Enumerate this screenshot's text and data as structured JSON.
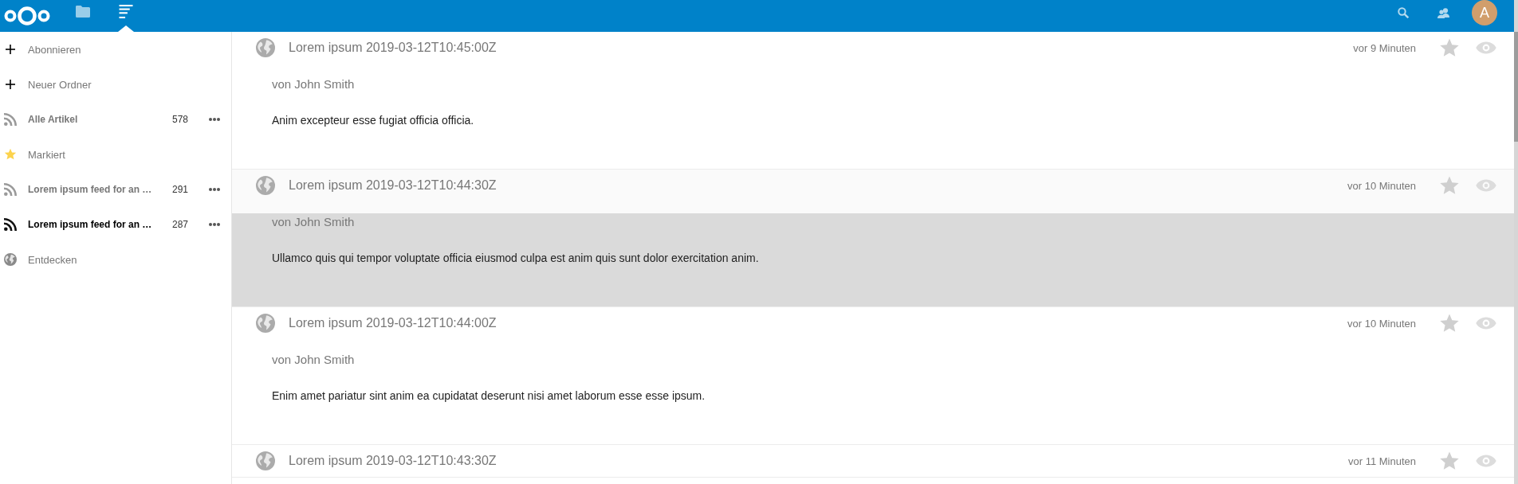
{
  "header": {
    "apps": [
      {
        "kind": "files",
        "selected": false
      },
      {
        "kind": "news",
        "selected": true
      }
    ],
    "avatar": {
      "initial": "A"
    }
  },
  "sidebar": {
    "items": [
      {
        "kind": "action",
        "label": "Abonnieren",
        "unread": false,
        "selected": false
      },
      {
        "kind": "action",
        "label": "Neuer Ordner",
        "unread": false,
        "selected": false
      },
      {
        "kind": "all",
        "label": "Alle Artikel",
        "count": "578",
        "unread": true,
        "selected": false
      },
      {
        "kind": "starred",
        "label": "Markiert",
        "unread": false,
        "selected": false
      },
      {
        "kind": "feed",
        "label": "Lorem ipsum feed for an …",
        "count": "291",
        "unread": true,
        "selected": false
      },
      {
        "kind": "feed",
        "label": "Lorem ipsum feed for an …",
        "count": "287",
        "unread": true,
        "selected": true
      },
      {
        "kind": "explore",
        "label": "Entdecken",
        "unread": false,
        "selected": false
      }
    ]
  },
  "articles": [
    {
      "title": "Lorem ipsum 2019-03-12T10:45:00Z",
      "time": "vor 9 Minuten",
      "starred": false,
      "selected": false,
      "author": "von John Smith",
      "body": "Anim excepteur esse fugiat officia officia."
    },
    {
      "title": "Lorem ipsum 2019-03-12T10:44:30Z",
      "time": "vor 10 Minuten",
      "starred": false,
      "selected": true,
      "author": "von John Smith",
      "body": "Ullamco quis qui tempor voluptate officia eiusmod culpa est anim quis sunt dolor exercitation anim."
    },
    {
      "title": "Lorem ipsum 2019-03-12T10:44:00Z",
      "time": "vor 10 Minuten",
      "starred": false,
      "selected": false,
      "author": "von John Smith",
      "body": "Enim amet pariatur sint anim ea cupidatat deserunt nisi amet laborum esse esse ipsum."
    },
    {
      "title": "Lorem ipsum 2019-03-12T10:43:30Z",
      "time": "vor 11 Minuten",
      "starred": false,
      "selected": false
    }
  ]
}
